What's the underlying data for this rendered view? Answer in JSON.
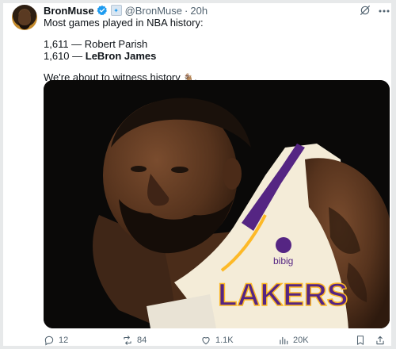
{
  "tweet": {
    "author_name": "BronMuse",
    "handle": "@BronMuse",
    "separator": "·",
    "time": "20h",
    "text_line1": "Most games played in NBA history:",
    "row1": "1,611 — Robert Parish",
    "row2_count": "1,610 — ",
    "row2_name": "LeBron James",
    "closing_text": "We're about to witness history ",
    "closing_emoji": "🐐",
    "closing_end": "."
  },
  "media": {
    "jersey_text": "LAKERS",
    "sponsor_text": "bibig"
  },
  "actions": {
    "replies": "12",
    "reposts": "84",
    "likes": "1.1K",
    "views": "20K"
  },
  "icons": [
    "avatar",
    "verified-badge-icon",
    "affiliate-badge-icon",
    "grok-icon",
    "more-icon",
    "reply-icon",
    "repost-icon",
    "like-icon",
    "views-icon",
    "bookmark-icon",
    "share-icon"
  ],
  "colors": {
    "text": "#0f1419",
    "secondary": "#536471",
    "verified": "#1d9bf0",
    "lakers_purple": "#552583",
    "lakers_gold": "#fdb927"
  }
}
